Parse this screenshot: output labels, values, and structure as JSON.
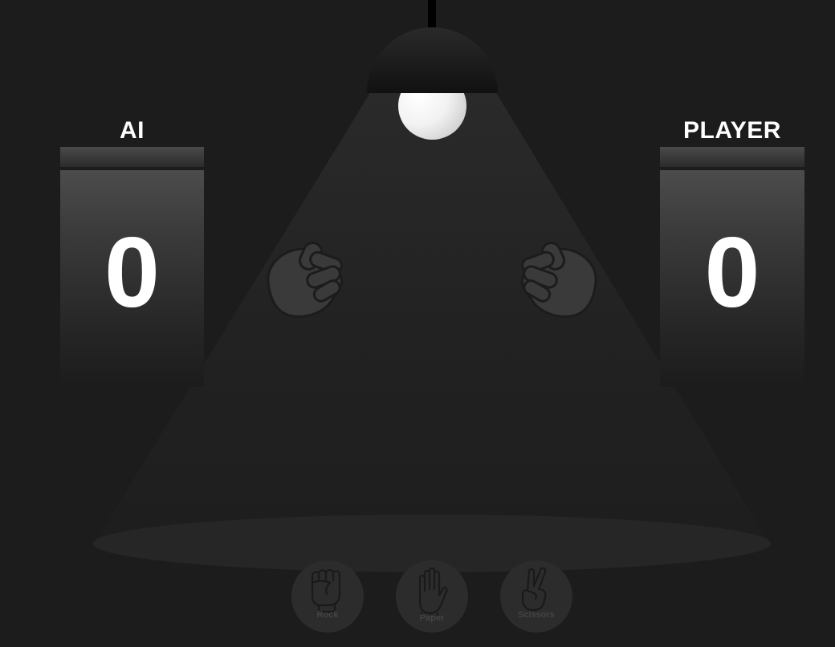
{
  "scoreboard": {
    "ai": {
      "label": "AI",
      "score": "0"
    },
    "player": {
      "label": "PLAYER",
      "score": "0"
    }
  },
  "choices": [
    {
      "id": "rock",
      "label": "Rock",
      "icon": "rock-hand-icon"
    },
    {
      "id": "paper",
      "label": "Paper",
      "icon": "paper-hand-icon"
    },
    {
      "id": "scissors",
      "label": "Scissors",
      "icon": "scissors-hand-icon"
    }
  ],
  "hands": {
    "ai": "fist-icon",
    "player": "fist-icon"
  },
  "colors": {
    "background": "#1c1c1c",
    "score_text": "#ffffff",
    "hand_fill": "#3a3a3a",
    "hand_stroke": "#1c1c1c",
    "button_fill": "#2c2c2c",
    "button_text": "#444444"
  }
}
